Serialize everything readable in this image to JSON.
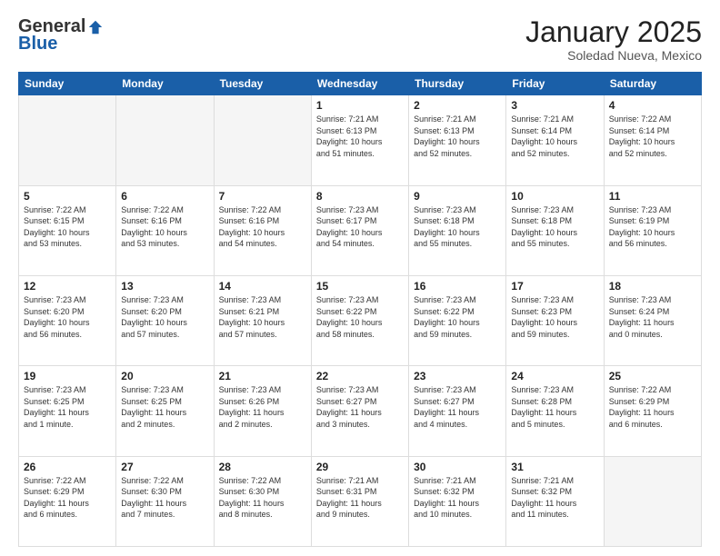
{
  "logo": {
    "general": "General",
    "blue": "Blue"
  },
  "header": {
    "month": "January 2025",
    "location": "Soledad Nueva, Mexico"
  },
  "weekdays": [
    "Sunday",
    "Monday",
    "Tuesday",
    "Wednesday",
    "Thursday",
    "Friday",
    "Saturday"
  ],
  "weeks": [
    [
      {
        "day": "",
        "info": ""
      },
      {
        "day": "",
        "info": ""
      },
      {
        "day": "",
        "info": ""
      },
      {
        "day": "1",
        "info": "Sunrise: 7:21 AM\nSunset: 6:13 PM\nDaylight: 10 hours\nand 51 minutes."
      },
      {
        "day": "2",
        "info": "Sunrise: 7:21 AM\nSunset: 6:13 PM\nDaylight: 10 hours\nand 52 minutes."
      },
      {
        "day": "3",
        "info": "Sunrise: 7:21 AM\nSunset: 6:14 PM\nDaylight: 10 hours\nand 52 minutes."
      },
      {
        "day": "4",
        "info": "Sunrise: 7:22 AM\nSunset: 6:14 PM\nDaylight: 10 hours\nand 52 minutes."
      }
    ],
    [
      {
        "day": "5",
        "info": "Sunrise: 7:22 AM\nSunset: 6:15 PM\nDaylight: 10 hours\nand 53 minutes."
      },
      {
        "day": "6",
        "info": "Sunrise: 7:22 AM\nSunset: 6:16 PM\nDaylight: 10 hours\nand 53 minutes."
      },
      {
        "day": "7",
        "info": "Sunrise: 7:22 AM\nSunset: 6:16 PM\nDaylight: 10 hours\nand 54 minutes."
      },
      {
        "day": "8",
        "info": "Sunrise: 7:23 AM\nSunset: 6:17 PM\nDaylight: 10 hours\nand 54 minutes."
      },
      {
        "day": "9",
        "info": "Sunrise: 7:23 AM\nSunset: 6:18 PM\nDaylight: 10 hours\nand 55 minutes."
      },
      {
        "day": "10",
        "info": "Sunrise: 7:23 AM\nSunset: 6:18 PM\nDaylight: 10 hours\nand 55 minutes."
      },
      {
        "day": "11",
        "info": "Sunrise: 7:23 AM\nSunset: 6:19 PM\nDaylight: 10 hours\nand 56 minutes."
      }
    ],
    [
      {
        "day": "12",
        "info": "Sunrise: 7:23 AM\nSunset: 6:20 PM\nDaylight: 10 hours\nand 56 minutes."
      },
      {
        "day": "13",
        "info": "Sunrise: 7:23 AM\nSunset: 6:20 PM\nDaylight: 10 hours\nand 57 minutes."
      },
      {
        "day": "14",
        "info": "Sunrise: 7:23 AM\nSunset: 6:21 PM\nDaylight: 10 hours\nand 57 minutes."
      },
      {
        "day": "15",
        "info": "Sunrise: 7:23 AM\nSunset: 6:22 PM\nDaylight: 10 hours\nand 58 minutes."
      },
      {
        "day": "16",
        "info": "Sunrise: 7:23 AM\nSunset: 6:22 PM\nDaylight: 10 hours\nand 59 minutes."
      },
      {
        "day": "17",
        "info": "Sunrise: 7:23 AM\nSunset: 6:23 PM\nDaylight: 10 hours\nand 59 minutes."
      },
      {
        "day": "18",
        "info": "Sunrise: 7:23 AM\nSunset: 6:24 PM\nDaylight: 11 hours\nand 0 minutes."
      }
    ],
    [
      {
        "day": "19",
        "info": "Sunrise: 7:23 AM\nSunset: 6:25 PM\nDaylight: 11 hours\nand 1 minute."
      },
      {
        "day": "20",
        "info": "Sunrise: 7:23 AM\nSunset: 6:25 PM\nDaylight: 11 hours\nand 2 minutes."
      },
      {
        "day": "21",
        "info": "Sunrise: 7:23 AM\nSunset: 6:26 PM\nDaylight: 11 hours\nand 2 minutes."
      },
      {
        "day": "22",
        "info": "Sunrise: 7:23 AM\nSunset: 6:27 PM\nDaylight: 11 hours\nand 3 minutes."
      },
      {
        "day": "23",
        "info": "Sunrise: 7:23 AM\nSunset: 6:27 PM\nDaylight: 11 hours\nand 4 minutes."
      },
      {
        "day": "24",
        "info": "Sunrise: 7:23 AM\nSunset: 6:28 PM\nDaylight: 11 hours\nand 5 minutes."
      },
      {
        "day": "25",
        "info": "Sunrise: 7:22 AM\nSunset: 6:29 PM\nDaylight: 11 hours\nand 6 minutes."
      }
    ],
    [
      {
        "day": "26",
        "info": "Sunrise: 7:22 AM\nSunset: 6:29 PM\nDaylight: 11 hours\nand 6 minutes."
      },
      {
        "day": "27",
        "info": "Sunrise: 7:22 AM\nSunset: 6:30 PM\nDaylight: 11 hours\nand 7 minutes."
      },
      {
        "day": "28",
        "info": "Sunrise: 7:22 AM\nSunset: 6:30 PM\nDaylight: 11 hours\nand 8 minutes."
      },
      {
        "day": "29",
        "info": "Sunrise: 7:21 AM\nSunset: 6:31 PM\nDaylight: 11 hours\nand 9 minutes."
      },
      {
        "day": "30",
        "info": "Sunrise: 7:21 AM\nSunset: 6:32 PM\nDaylight: 11 hours\nand 10 minutes."
      },
      {
        "day": "31",
        "info": "Sunrise: 7:21 AM\nSunset: 6:32 PM\nDaylight: 11 hours\nand 11 minutes."
      },
      {
        "day": "",
        "info": ""
      }
    ]
  ]
}
